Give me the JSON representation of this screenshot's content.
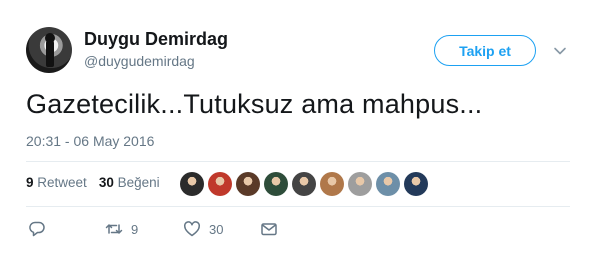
{
  "user": {
    "name": "Duygu Demirdag",
    "handle": "@duygudemirdag"
  },
  "follow_button": {
    "label": "Takip et"
  },
  "tweet": {
    "text": "Gazetecilik...Tutuksuz ama mahpus...",
    "timestamp": "20:31 - 06 May 2016"
  },
  "stats": {
    "retweets_count": "9",
    "retweets_label": "Retweet",
    "likes_count": "30",
    "likes_label": "Beğeni"
  },
  "likers": [
    {
      "color": "#2b2b2b"
    },
    {
      "color": "#c0392b"
    },
    {
      "color": "#5a3a28"
    },
    {
      "color": "#2e4d3a"
    },
    {
      "color": "#444444"
    },
    {
      "color": "#b0784a"
    },
    {
      "color": "#9e9e9e"
    },
    {
      "color": "#6d8fa8"
    },
    {
      "color": "#233a5a"
    }
  ],
  "actions": {
    "reply_count": "",
    "retweet_count": "9",
    "like_count": "30"
  },
  "colors": {
    "accent": "#1da1f2",
    "secondary_text": "#657786",
    "divider": "#e6ecf0"
  }
}
